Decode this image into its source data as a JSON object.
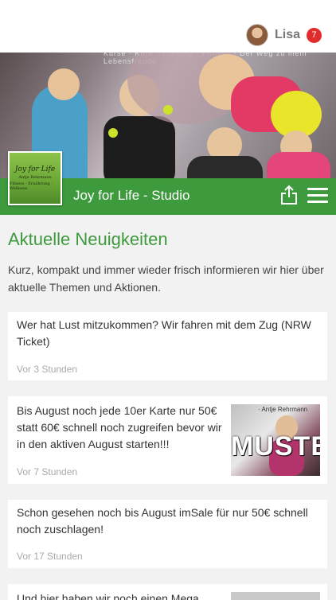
{
  "header": {
    "user_name": "Lisa",
    "notification_count": "7"
  },
  "hero": {
    "caption": "Kurse · Kurs · Training · Fitness · Der Weg zu mehr Lebensfreude",
    "logo_title": "Joy for Life",
    "logo_lines": [
      "Antje Rehrmann",
      "Fitness · Ernährung · Wellness"
    ]
  },
  "studio": {
    "title": "Joy for Life - Studio"
  },
  "news": {
    "heading": "Aktuelle Neuigkeiten",
    "intro": "Kurz, kompakt und immer wieder frisch informieren wir hier über aktuelle Themen und Aktionen.",
    "items": [
      {
        "text": "Wer hat Lust mitzukommen? Wir fahren mit dem Zug (NRW Ticket)",
        "time": "Vor 3 Stunden"
      },
      {
        "text": "Bis August noch jede 10er Karte nur 50€ statt 60€ schnell noch zugreifen bevor wir in den aktiven August starten!!!",
        "time": "Vor 7 Stunden",
        "thumb_caption": "· Antje Rehrmann",
        "thumb_stamp": "MUSTER"
      },
      {
        "text": "Schon gesehen noch bis August imSale für nur 50€ schnell noch zuschlagen!",
        "time": "Vor 17 Stunden"
      },
      {
        "text": "Und hier haben wir noch einen Mega"
      }
    ]
  },
  "colors": {
    "brand_green": "#3d9a3d",
    "badge_red": "#e22b2b"
  }
}
